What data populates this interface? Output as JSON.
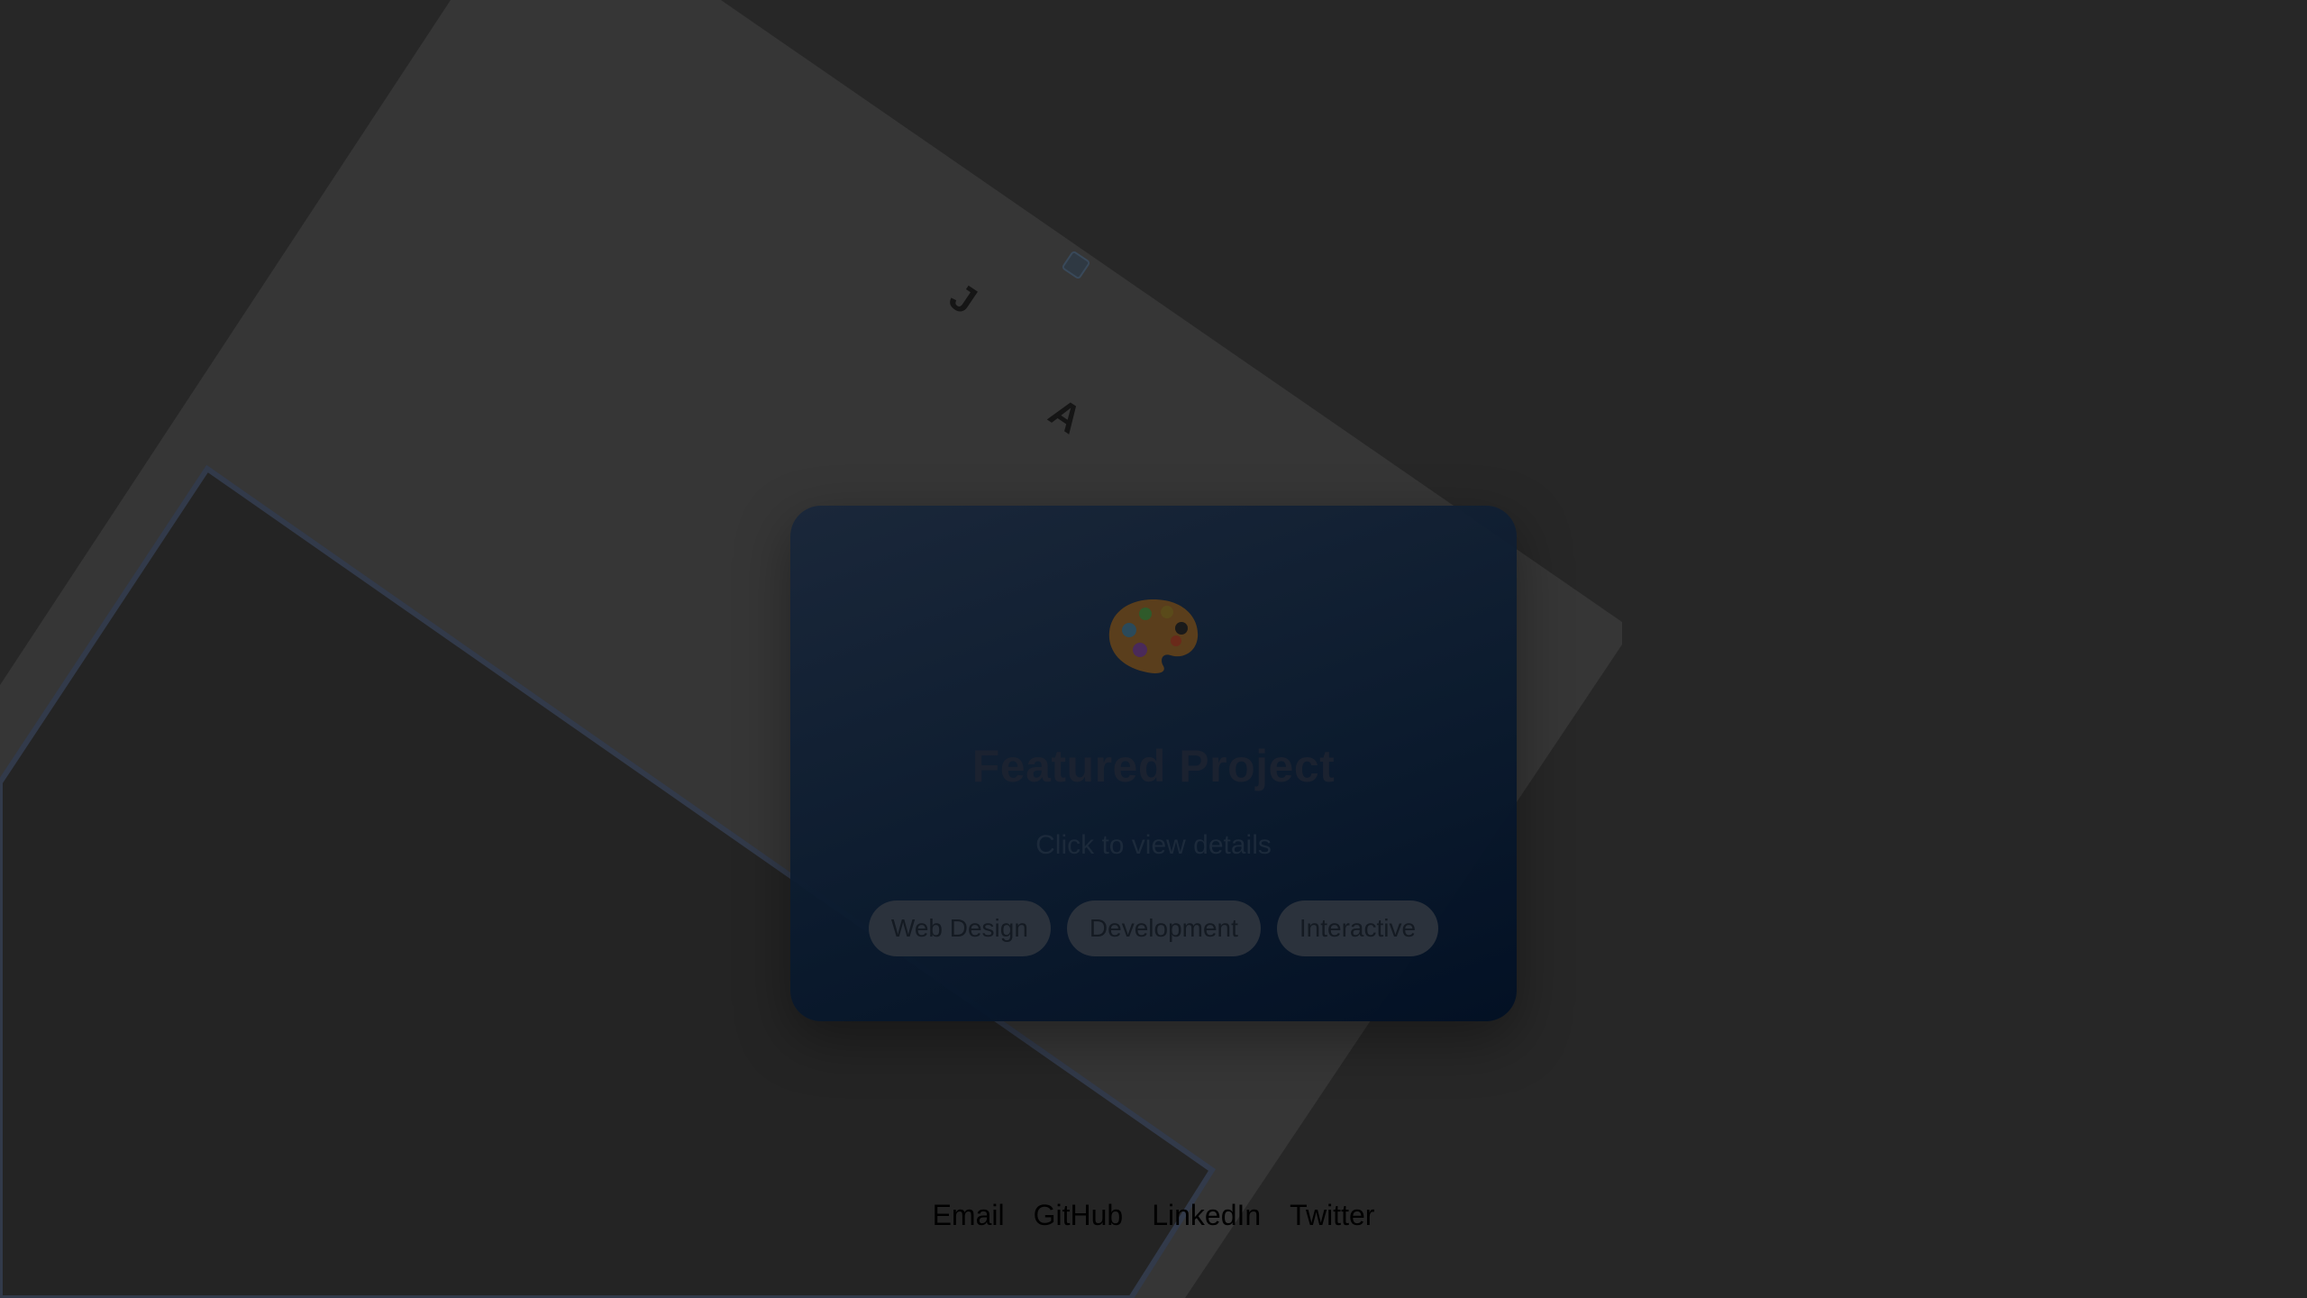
{
  "card": {
    "icon": "artist-palette-icon",
    "title": "Featured Project",
    "subtitle": "Click to view details",
    "tags": [
      "Web Design",
      "Development",
      "Interactive"
    ]
  },
  "footer": {
    "links": [
      "Email",
      "GitHub",
      "LinkedIn",
      "Twitter"
    ]
  },
  "background": {
    "letters": [
      "J",
      "A"
    ],
    "page_color": "#272727",
    "accent_color": "#0b1a2e"
  }
}
